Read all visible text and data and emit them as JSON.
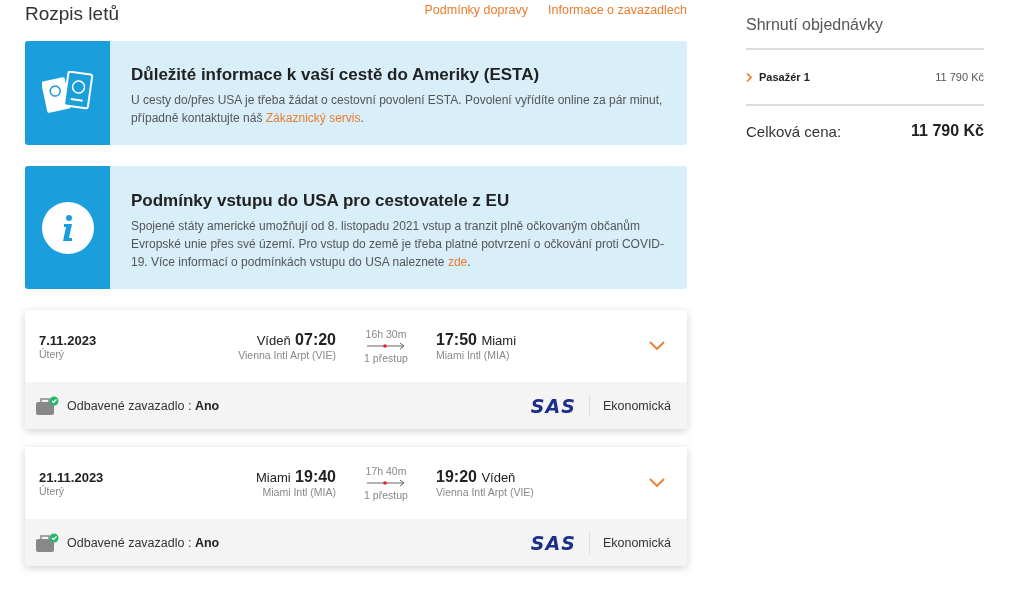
{
  "header": {
    "title": "Rozpis letů",
    "links": [
      "Podmínky dopravy",
      "Informace o zavazadlech"
    ]
  },
  "notices": [
    {
      "kind": "passports",
      "title": "Důležité informace k vaší cestě do Ameriky (ESTA)",
      "text": "U cesty do/přes USA je třeba žádat o cestovní povolení ESTA. Povolení vyřídíte online za pár minut, případně kontaktujte náš",
      "link": "Zákaznický servis",
      "after": "."
    },
    {
      "kind": "info",
      "title": "Podmínky vstupu do USA pro cestovatele z EU",
      "text": "Spojené státy americké umožňují od 8. listopadu 2021 vstup a tranzit plně očkovaným občanům Evropské unie přes své území. Pro vstup do země je třeba platné potvrzení o očkování proti COVID-19. Více informací o podmínkách vstupu do USA naleznete",
      "link": "zde",
      "after": "."
    }
  ],
  "flights": [
    {
      "date": "7.11.2023",
      "weekday": "Úterý",
      "from_city": "Vídeň",
      "dep_time": "07:20",
      "from_airport": "Vienna Intl Arpt (VIE)",
      "duration": "16h 30m",
      "stops": "1 přestup",
      "arr_time": "17:50",
      "to_city": "Miami",
      "to_airport": "Miami Intl (MIA)",
      "expanded": false,
      "baggage_label": "Odbavené zavazadlo :",
      "baggage_value": "Ano",
      "baggage_included": true,
      "airline": "SAS",
      "cabin": "Ekonomická"
    },
    {
      "date": "21.11.2023",
      "weekday": "Úterý",
      "from_city": "Miami",
      "dep_time": "19:40",
      "from_airport": "Miami Intl (MIA)",
      "duration": "17h 40m",
      "stops": "1 přestup",
      "arr_time": "19:20",
      "to_city": "Vídeň",
      "to_airport": "Vienna Intl Arpt (VIE)",
      "expanded": false,
      "baggage_label": "Odbavené zavazadlo :",
      "baggage_value": "Ano",
      "baggage_included": true,
      "airline": "SAS",
      "cabin": "Ekonomická"
    }
  ],
  "summary": {
    "title": "Shrnutí objednávky",
    "items": [
      {
        "label": "Pasažér 1",
        "price": "11 790 Kč",
        "expanded": false
      }
    ],
    "total_label": "Celková cena:",
    "total": "11 790 Kč"
  }
}
